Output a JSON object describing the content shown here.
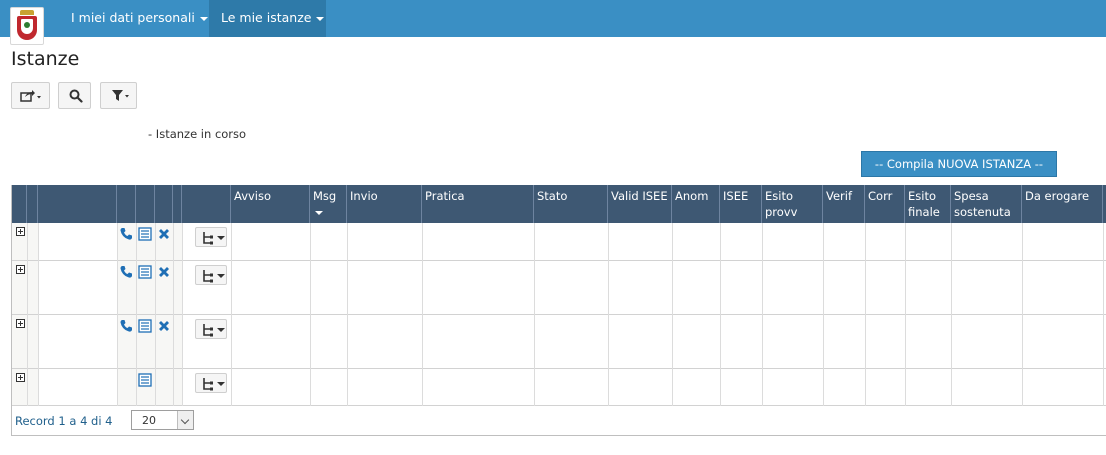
{
  "nav": {
    "items": [
      {
        "label": "I miei dati personali"
      },
      {
        "label": "Le mie istanze"
      }
    ]
  },
  "page": {
    "title": "Istanze",
    "section_label": "- Istanze in corso",
    "new_button_label": "-- Compila NUOVA ISTANZA --"
  },
  "toolbar": {
    "icons": [
      "export-icon",
      "search-icon",
      "filter-icon"
    ]
  },
  "table": {
    "columns": [
      {
        "label": ""
      },
      {
        "label": ""
      },
      {
        "label": ""
      },
      {
        "label": ""
      },
      {
        "label": ""
      },
      {
        "label": ""
      },
      {
        "label": ""
      },
      {
        "label": ""
      },
      {
        "label": "Avviso"
      },
      {
        "label": "Msg"
      },
      {
        "label": "Invio"
      },
      {
        "label": "Pratica"
      },
      {
        "label": "Stato"
      },
      {
        "label": "Valid ISEE"
      },
      {
        "label": "Anom"
      },
      {
        "label": "ISEE"
      },
      {
        "label": "Esito provv"
      },
      {
        "label": "Verif"
      },
      {
        "label": "Corr"
      },
      {
        "label": "Esito finale"
      },
      {
        "label": "Spesa sostenuta"
      },
      {
        "label": "Da erogare"
      }
    ],
    "rows": [
      {
        "has_phone": true,
        "has_detail": true,
        "has_delete": true
      },
      {
        "has_phone": true,
        "has_detail": true,
        "has_delete": true
      },
      {
        "has_phone": true,
        "has_detail": true,
        "has_delete": true
      },
      {
        "has_phone": false,
        "has_detail": true,
        "has_delete": false
      }
    ]
  },
  "pager": {
    "record_text": "Record 1 a 4 di 4",
    "page_size": "20"
  },
  "colors": {
    "navbar": "#3a8fc4",
    "table_header": "#3e5873",
    "icon_blue": "#1f6fb5"
  }
}
